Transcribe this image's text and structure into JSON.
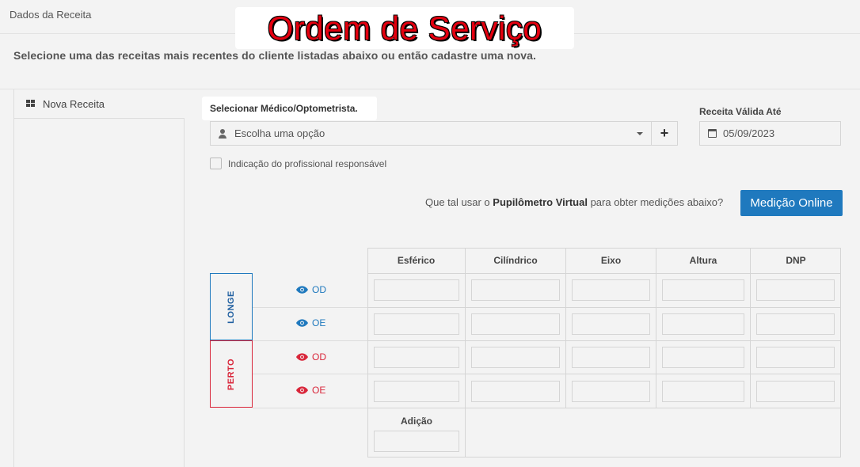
{
  "header": {
    "title": "Dados da Receita"
  },
  "overlay": {
    "text": "Ordem de Serviço"
  },
  "instruction": "Selecione uma das receitas mais recentes do cliente listadas abaixo ou então cadastre uma nova.",
  "sidebar": {
    "items": [
      {
        "label": "Nova Receita",
        "icon": "grid-icon"
      }
    ]
  },
  "form": {
    "doctor_label": "Selecionar Médico/Optometrista.",
    "doctor_select_value": "Escolha uma opção",
    "add_button": "+",
    "date_label": "Receita Válida Até",
    "date_value": "05/09/2023",
    "checkbox_label": "Indicação do profissional responsável"
  },
  "promo": {
    "prefix": "Que tal usar o ",
    "bold": "Pupilômetro Virtual",
    "suffix": " para obter medições abaixo?",
    "button": "Medição Online"
  },
  "table": {
    "columns": [
      "Esférico",
      "Cilíndrico",
      "Eixo",
      "Altura",
      "DNP"
    ],
    "groups": [
      {
        "label": "LONGE",
        "color": "#1f79be",
        "rows": [
          "OD",
          "OE"
        ]
      },
      {
        "label": "PERTO",
        "color": "#d9263a",
        "rows": [
          "OD",
          "OE"
        ]
      }
    ],
    "addition_label": "Adição"
  },
  "colors": {
    "primary": "#1f79be",
    "danger": "#d9263a",
    "overlay_text": "#e3000f"
  }
}
